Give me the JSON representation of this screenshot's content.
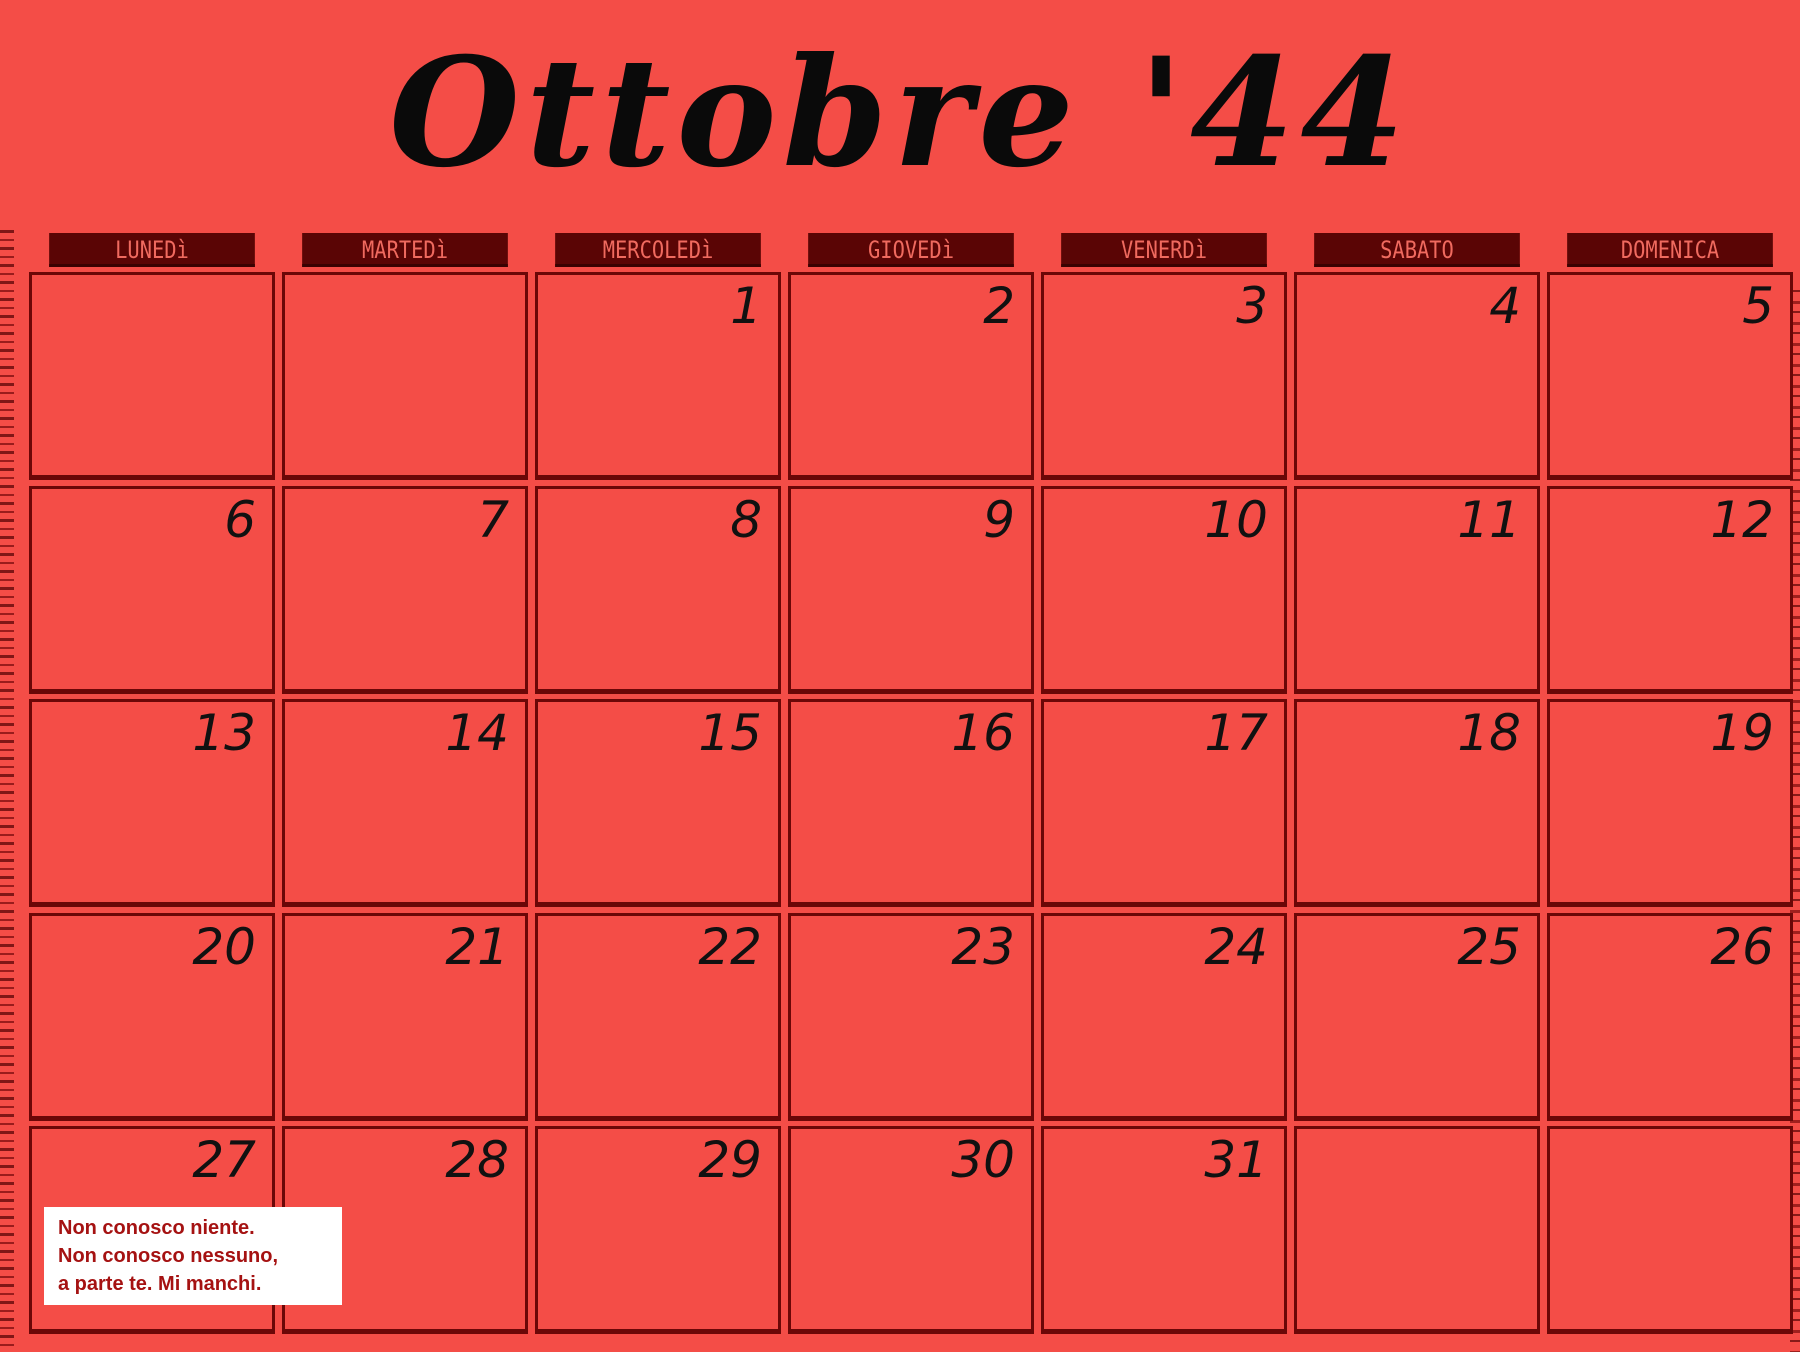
{
  "calendar": {
    "title": "Ottobre '44",
    "weekdays": [
      "LUNEDì",
      "MARTEDì",
      "MERCOLEDì",
      "GIOVEDì",
      "VENERDì",
      "SABATO",
      "DOMENICA"
    ],
    "weeks": [
      [
        "",
        "",
        "1",
        "2",
        "3",
        "4",
        "5"
      ],
      [
        "6",
        "7",
        "8",
        "9",
        "10",
        "11",
        "12"
      ],
      [
        "13",
        "14",
        "15",
        "16",
        "17",
        "18",
        "19"
      ],
      [
        "20",
        "21",
        "22",
        "23",
        "24",
        "25",
        "26"
      ],
      [
        "27",
        "28",
        "29",
        "30",
        "31",
        "",
        ""
      ]
    ]
  },
  "note": {
    "lines": [
      "Non conosco niente.",
      "Non conosco nessuno,",
      "a parte te. Mi manchi."
    ]
  },
  "colors": {
    "background": "#f44d47",
    "header_bar": "#5a0505",
    "grid_lines": "#6b0707",
    "note_text": "#a51212"
  }
}
